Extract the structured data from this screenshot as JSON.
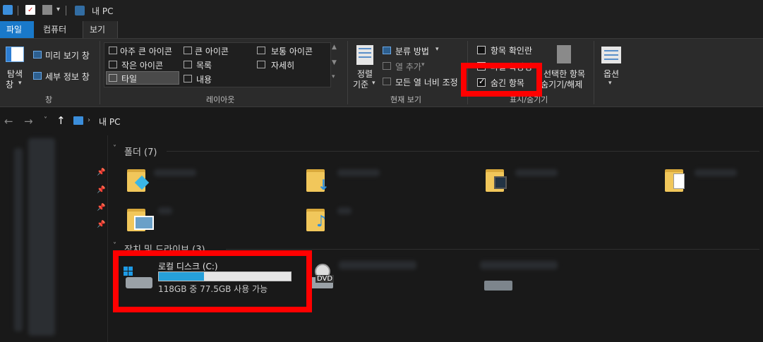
{
  "window": {
    "title": "내 PC"
  },
  "ribbon_tabs": {
    "file": "파일",
    "computer": "컴퓨터",
    "view": "보기"
  },
  "ribbon": {
    "pane_group": {
      "navigation_pane": "탐색\n창",
      "nav_line1": "탐색",
      "nav_line2": "창",
      "preview_pane": "미리 보기 창",
      "details_pane": "세부 정보 창",
      "label": "창"
    },
    "layout_group": {
      "extra_large": "아주 큰 아이콘",
      "large": "큰 아이콘",
      "medium": "보통 아이콘",
      "small": "작은 아이콘",
      "list": "목록",
      "details": "자세히",
      "tiles": "타일",
      "content": "내용",
      "label": "레이아웃"
    },
    "current_view_group": {
      "sort_line1": "정렬",
      "sort_line2": "기준",
      "group_by": "분류 방법",
      "add_columns": "열 추가",
      "size_all_columns": "모든 열 너비 조정",
      "label": "현재 보기"
    },
    "show_hide_group": {
      "item_checkboxes": "항목 확인란",
      "file_name_extensions": "파일 확장명",
      "hidden_items": "숨긴 항목",
      "hide_selected_line1": "선택한 항목",
      "hide_selected_line2": "숨기기/해제",
      "label": "표시/숨기기"
    },
    "options": {
      "label": "옵션"
    }
  },
  "address": {
    "path": "내 PC"
  },
  "content": {
    "folders_header": "폴더 (7)",
    "drives_header": "장치 및 드라이브 (3)",
    "local_disk": {
      "name": "로컬 디스크 (C:)",
      "space_text": "118GB 중 77.5GB 사용 가능",
      "used_fraction": 0.34
    },
    "dvd_label": "DVD"
  },
  "colors": {
    "accent": "#1979ca",
    "highlight_box": "#ff0000",
    "folder": "#f1c75b"
  }
}
